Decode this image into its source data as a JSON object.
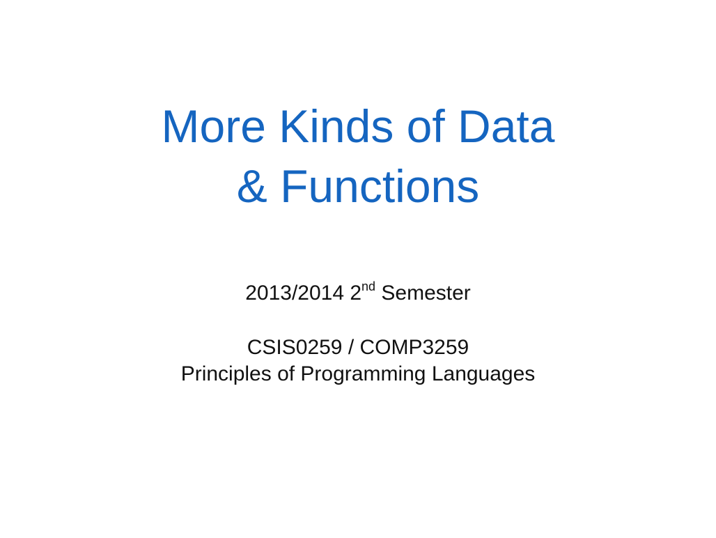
{
  "slide": {
    "title_line_1": "More Kinds of Data",
    "title_line_2": "& Functions",
    "semester": {
      "prefix": "2013/2014 2",
      "superscript": "nd",
      "suffix": " Semester"
    },
    "course_code": "CSIS0259 / COMP3259",
    "course_name": "Principles of Programming Languages"
  },
  "colors": {
    "title": "#1565c0",
    "body_text": "#111111",
    "background": "#ffffff"
  }
}
